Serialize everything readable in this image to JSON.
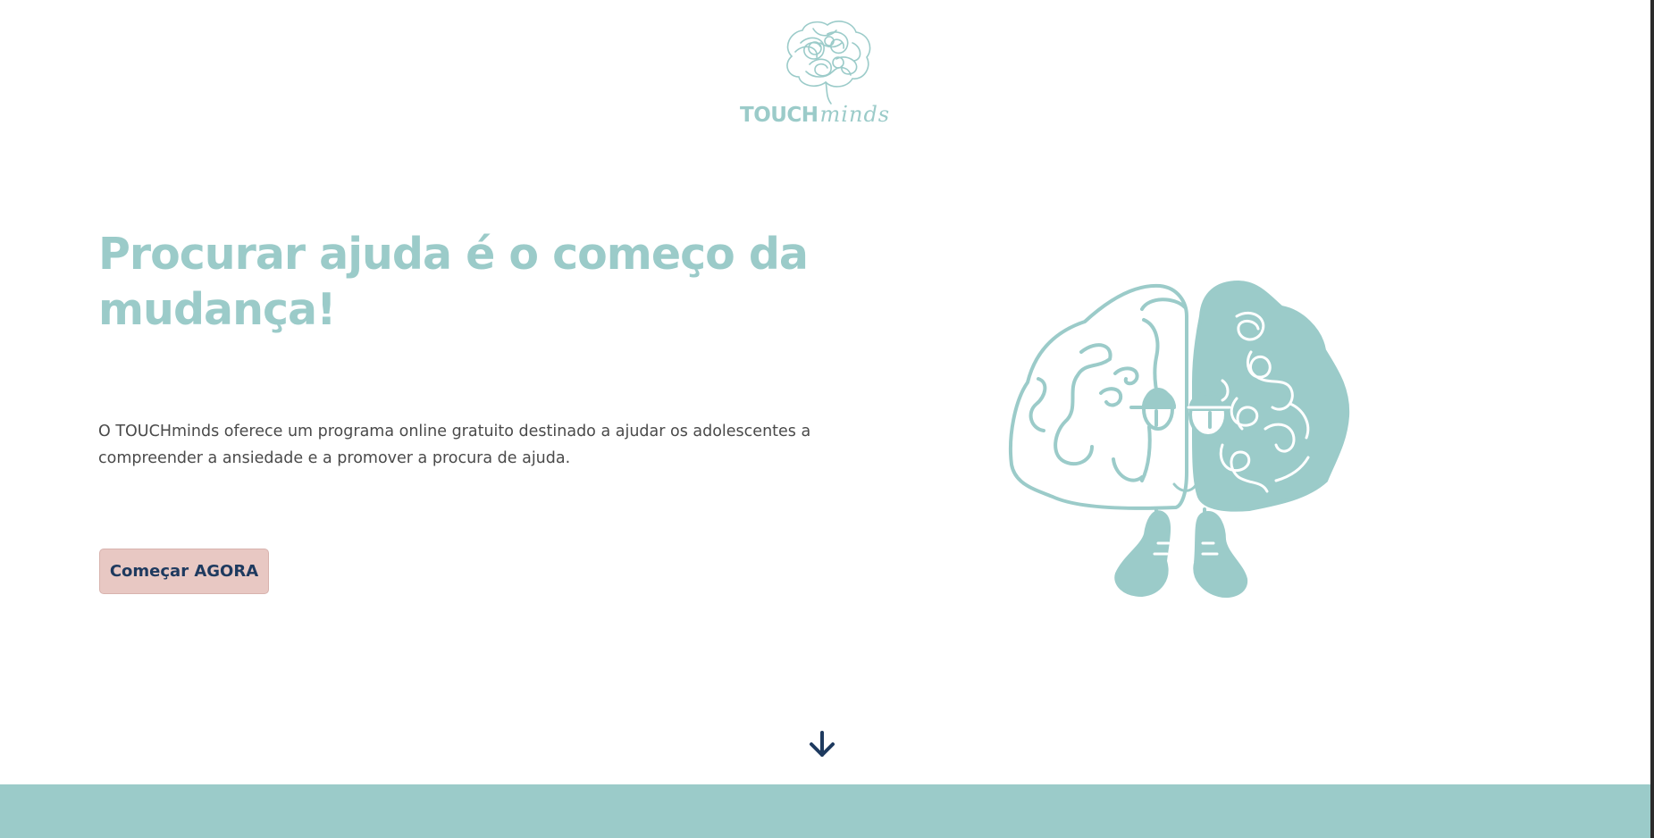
{
  "colors": {
    "brand_teal": "#9bcbc9",
    "button_bg": "#e8c8c3",
    "button_text": "#1e3a5f",
    "body_text": "#4a4a4a",
    "arrow": "#1e3a5f"
  },
  "header": {
    "logo": {
      "word_bold": "TOUCH",
      "word_script": "minds",
      "icon": "brain-scribble-icon"
    }
  },
  "hero": {
    "title": "Procurar ajuda é o começo da mudança!",
    "description": "O TOUCHminds oferece um programa online gratuito destinado a ajudar os adolescentes a compreender a ansiedade e a promover a procura de ajuda.",
    "cta_label": "Começar AGORA",
    "illustration": "brain-character-illustration"
  },
  "scroll": {
    "icon": "arrow-down-icon"
  }
}
